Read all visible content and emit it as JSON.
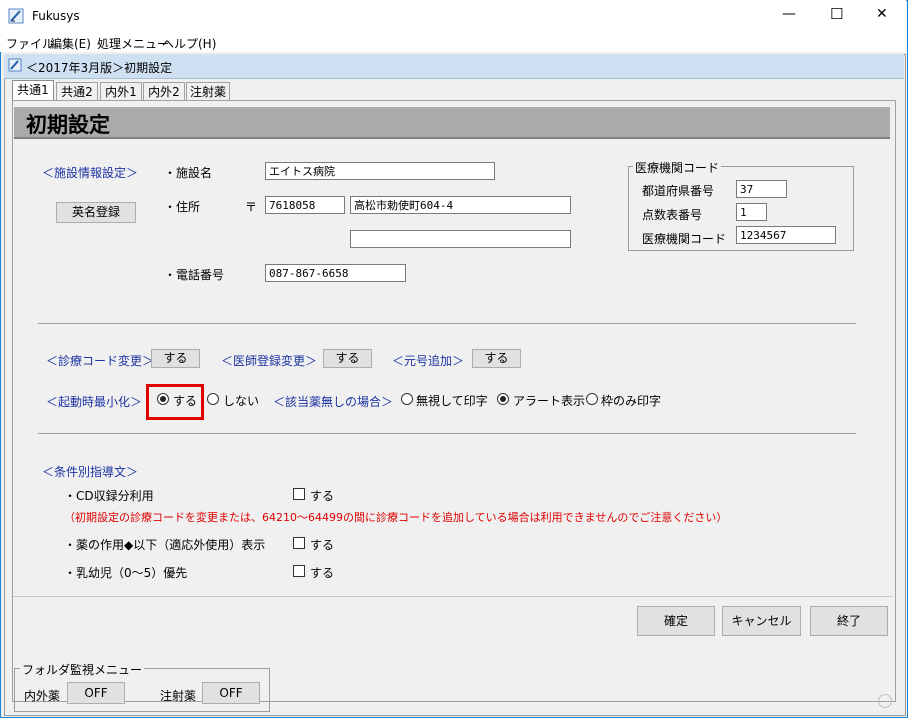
{
  "window": {
    "title": "Fukusys",
    "controls": {
      "minimize": "—",
      "maximize": "☐",
      "close": "✕"
    }
  },
  "menu": [
    "ファイル",
    "編集(E)",
    "処理メニュー",
    "ヘルプ(H)"
  ],
  "child": {
    "title": "＜2017年3月版＞初期設定"
  },
  "tabs": [
    {
      "label": "共通1",
      "active": true
    },
    {
      "label": "共通2",
      "active": false
    },
    {
      "label": "内外1",
      "active": false
    },
    {
      "label": "内外2",
      "active": false
    },
    {
      "label": "注射薬",
      "active": false
    }
  ],
  "header": {
    "title": "初期設定"
  },
  "facility": {
    "section_label": "＜施設情報設定＞",
    "english_btn": "英名登録",
    "name_label": "・施設名",
    "name_value": "エイトス病院",
    "address_label": "・住所",
    "postal_mark": "〒",
    "postal_value": "7618058",
    "address1_value": "高松市勅使町604-4",
    "address2_value": "",
    "phone_label": "・電話番号",
    "phone_value": "087-867-6658"
  },
  "medical_code": {
    "group_label": "医療機関コード",
    "prefecture_label": "都道府県番号",
    "prefecture_value": "37",
    "points_label": "点数表番号",
    "points_value": "1",
    "code_label": "医療機関コード",
    "code_value": "1234567"
  },
  "options": {
    "diag_code_label": "＜診療コード変更＞",
    "diag_code_btn": "する",
    "doctor_label": "＜医師登録変更＞",
    "doctor_btn": "する",
    "era_label": "＜元号追加＞",
    "era_btn": "する",
    "minimize_label": "＜起動時最小化＞",
    "minimize_yes": "する",
    "minimize_no": "しない",
    "minimize_selected": "yes",
    "nodrug_label": "＜該当薬無しの場合＞",
    "nodrug_ignore": "無視して印字",
    "nodrug_alert": "アラート表示",
    "nodrug_frame": "枠のみ印字",
    "nodrug_selected": "alert"
  },
  "guidance": {
    "section_label": "＜条件別指導文＞",
    "cd_label": "・CD収録分利用",
    "cd_check": "する",
    "warning": "（初期設定の診療コードを変更または、64210～64499の間に診療コードを追加している場合は利用できませんのでご注意ください）",
    "drug_label": "・薬の作用◆以下（適応外使用）表示",
    "drug_check": "する",
    "infant_label": "・乳幼児（0～5）優先",
    "infant_check": "する"
  },
  "footer_buttons": {
    "confirm": "確定",
    "cancel": "キャンセル",
    "exit": "終了"
  },
  "folder_monitor": {
    "group_label": "フォルダ監視メニュー",
    "internal_label": "内外薬",
    "internal_btn": "OFF",
    "injection_label": "注射薬",
    "injection_btn": "OFF"
  },
  "colors": {
    "label_blue": "#1d33a3",
    "warning_red": "#e00000",
    "highlight": "#e00000"
  }
}
